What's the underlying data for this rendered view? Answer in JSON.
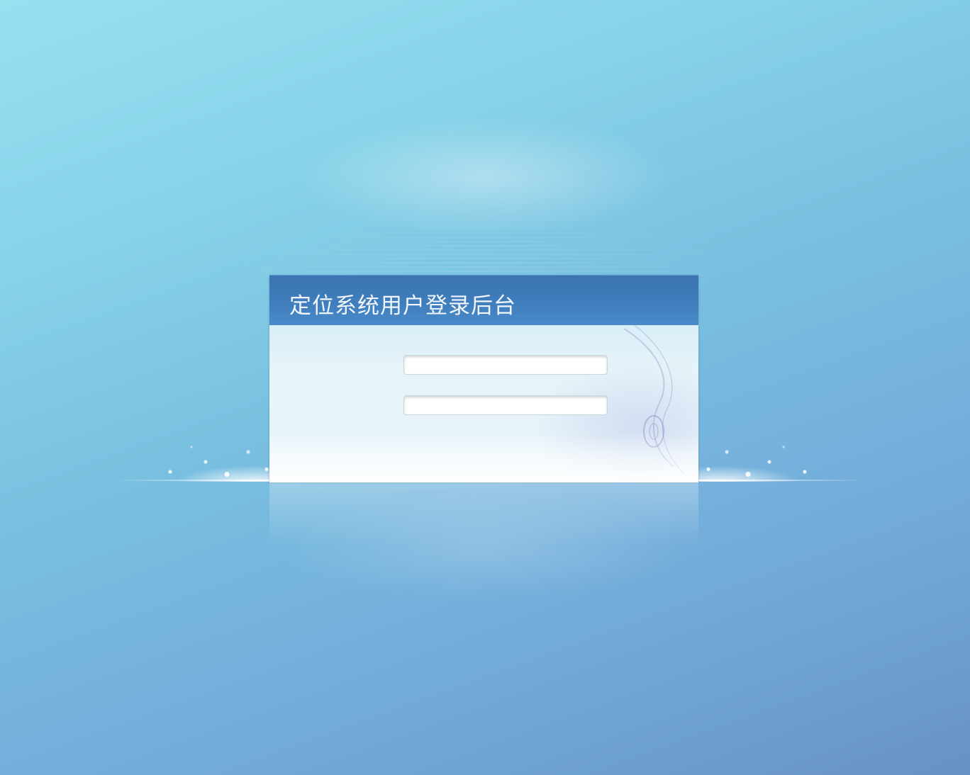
{
  "login": {
    "title": "定位系统用户登录后台",
    "username": {
      "value": "",
      "placeholder": ""
    },
    "password": {
      "value": "",
      "placeholder": ""
    }
  },
  "colors": {
    "header": "#3f7dbd",
    "background_top": "#96e0f0",
    "background_bottom": "#6791c6",
    "title_text": "#f0f6fc"
  }
}
